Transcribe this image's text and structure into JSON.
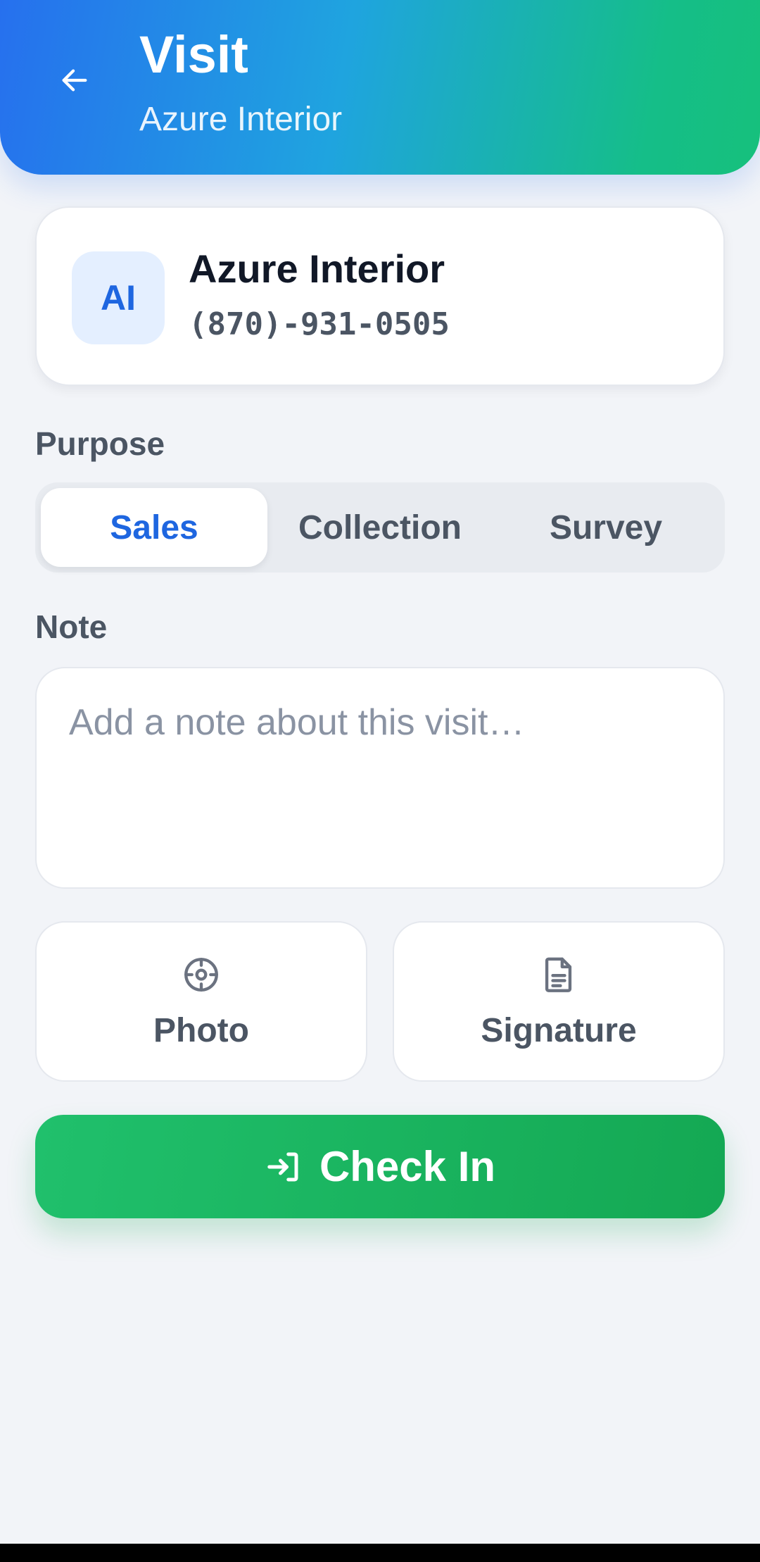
{
  "header": {
    "title": "Visit",
    "subtitle": "Azure Interior",
    "back_icon": "arrow-left-icon"
  },
  "customer": {
    "initials": "AI",
    "name": "Azure Interior",
    "phone": "(870)-931-0505"
  },
  "purpose": {
    "label": "Purpose",
    "options": [
      "Sales",
      "Collection",
      "Survey"
    ],
    "selected": "Sales"
  },
  "note": {
    "label": "Note",
    "value": "",
    "placeholder": "Add a note about this visit…"
  },
  "attachments": {
    "photo": {
      "label": "Photo",
      "icon": "crosshair-icon"
    },
    "signature": {
      "label": "Signature",
      "icon": "document-icon"
    }
  },
  "actions": {
    "checkin_label": "Check In",
    "checkin_icon": "login-icon"
  },
  "colors": {
    "accent_blue": "#1e66e0",
    "accent_green": "#16a85a",
    "header_gradient_start": "#2670ee",
    "header_gradient_end": "#16c07c",
    "background": "#f2f4f8"
  }
}
